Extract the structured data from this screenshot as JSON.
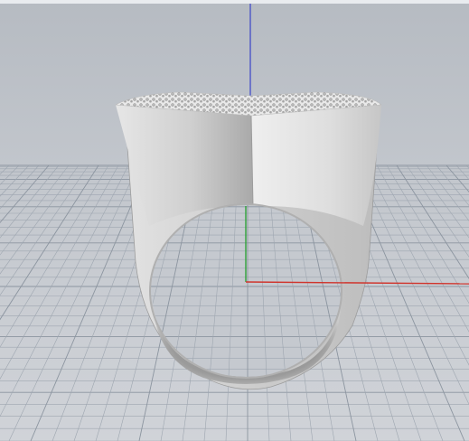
{
  "viewport": {
    "kind": "perspective-3d-view",
    "background_top_color": "#b9bec5",
    "background_bottom_color": "#cdd1d6",
    "grid_line_color": "#9ea6b0",
    "grid_major_line_color": "#8c95a0"
  },
  "axes": {
    "x_axis_color": "#d0342c",
    "y_axis_color": "#2fa33a",
    "z_axis_color": "#3a44c8"
  },
  "model": {
    "name": "signet-ring",
    "material_color": "#d8d8d8",
    "top_surface": "pave-stone-texture"
  }
}
